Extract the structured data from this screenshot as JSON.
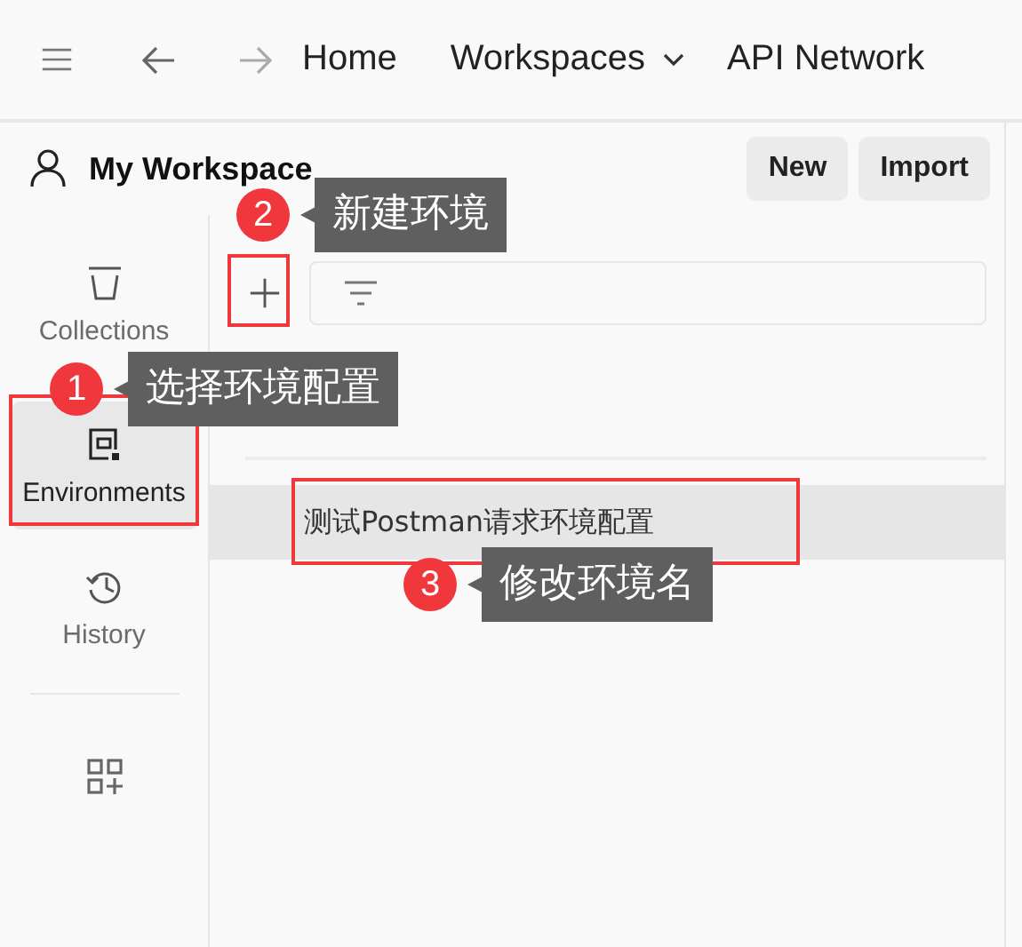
{
  "topbar": {
    "nav": [
      {
        "label": "Home",
        "dropdown": false
      },
      {
        "label": "Workspaces",
        "dropdown": true
      },
      {
        "label": "API Network",
        "dropdown": false
      }
    ]
  },
  "workspace": {
    "name": "My Workspace",
    "buttons": [
      "New",
      "Import"
    ]
  },
  "sidebar": {
    "items": [
      {
        "label": "Collections",
        "selected": false
      },
      {
        "label": "Environments",
        "selected": true
      },
      {
        "label": "History",
        "selected": false
      }
    ]
  },
  "environments_panel": {
    "environments": [
      {
        "name": "测试Postman请求环境配置",
        "selected": true
      }
    ]
  },
  "annotations": [
    {
      "number": "1",
      "text": "选择环境配置"
    },
    {
      "number": "2",
      "text": "新建环境"
    },
    {
      "number": "3",
      "text": "修改环境名"
    }
  ]
}
